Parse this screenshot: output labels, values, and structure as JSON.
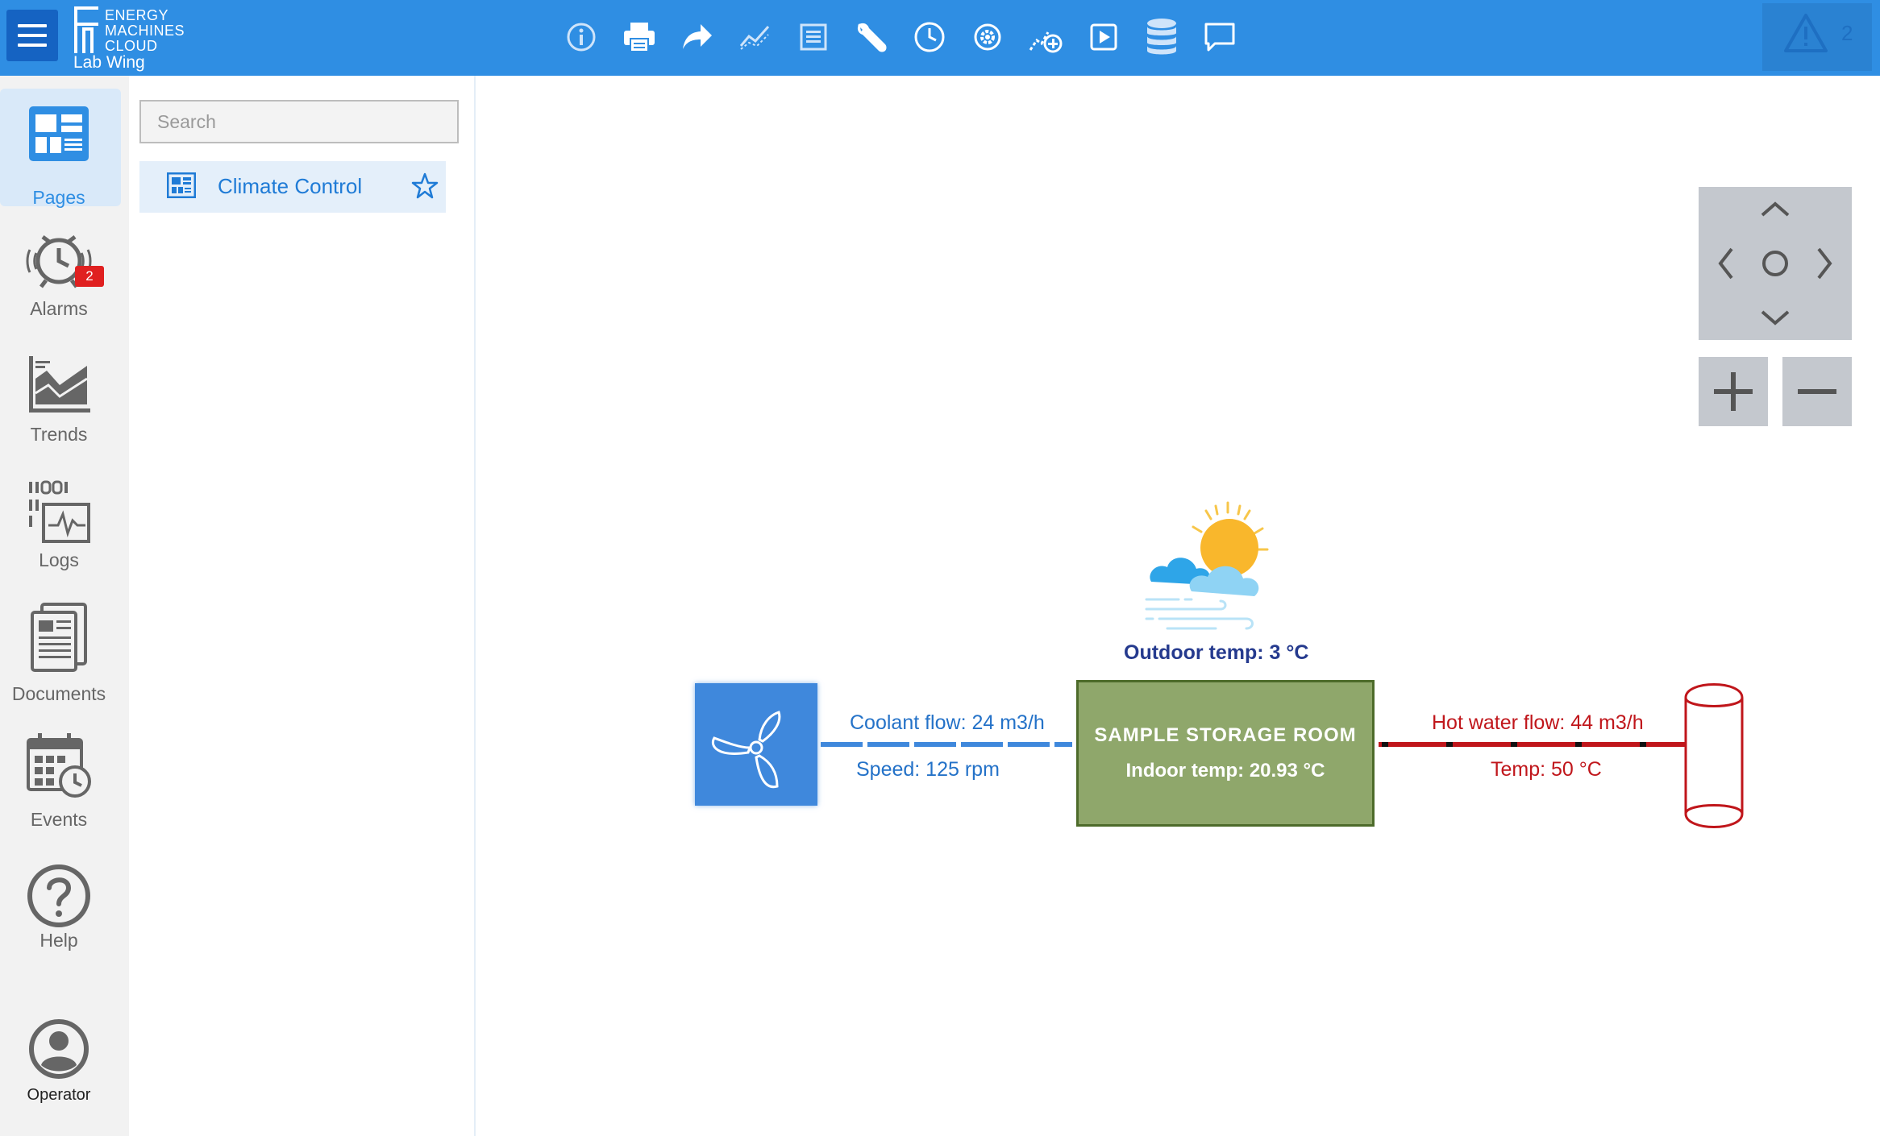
{
  "header": {
    "logo_line1": "ENERGY",
    "logo_line2": "MACHINES",
    "logo_line3": "CLOUD",
    "site_name": "Lab Wing",
    "toolbar_icons": [
      "info-icon",
      "print-icon",
      "share-icon",
      "trend-icon",
      "document-icon",
      "wrench-icon",
      "clock-icon",
      "settings-icon",
      "add-trend-icon",
      "play-icon",
      "database-icon",
      "comment-icon"
    ],
    "alert_count": "2",
    "colors": {
      "bar": "#2f8ee3",
      "menu": "#1563c2"
    }
  },
  "sidebar": {
    "items": [
      {
        "label": "Pages",
        "icon": "pages-icon",
        "active": true
      },
      {
        "label": "Alarms",
        "icon": "alarm-clock-icon",
        "badge": "2"
      },
      {
        "label": "Trends",
        "icon": "trends-chart-icon"
      },
      {
        "label": "Logs",
        "icon": "logs-icon"
      },
      {
        "label": "Documents",
        "icon": "documents-icon"
      },
      {
        "label": "Events",
        "icon": "events-calendar-icon"
      },
      {
        "label": "Help",
        "icon": "help-icon"
      },
      {
        "label": "Operator",
        "icon": "user-icon"
      }
    ]
  },
  "pages_panel": {
    "search_placeholder": "Search",
    "pages": [
      {
        "label": "Climate Control",
        "favorite": false
      }
    ]
  },
  "diagram": {
    "outdoor_temp": "Outdoor temp: 3 °C",
    "coolant_flow": "Coolant flow: 24 m3/h",
    "fan_speed": "Speed: 125 rpm",
    "room_title": "SAMPLE STORAGE ROOM",
    "indoor_temp": "Indoor temp: 20.93 °C",
    "hot_water_flow": "Hot water flow: 44 m3/h",
    "hot_water_temp": "Temp: 50 °C",
    "colors": {
      "coolant": "#3f88dc",
      "hot_water": "#c0161b",
      "room": "#8fa76b"
    }
  }
}
